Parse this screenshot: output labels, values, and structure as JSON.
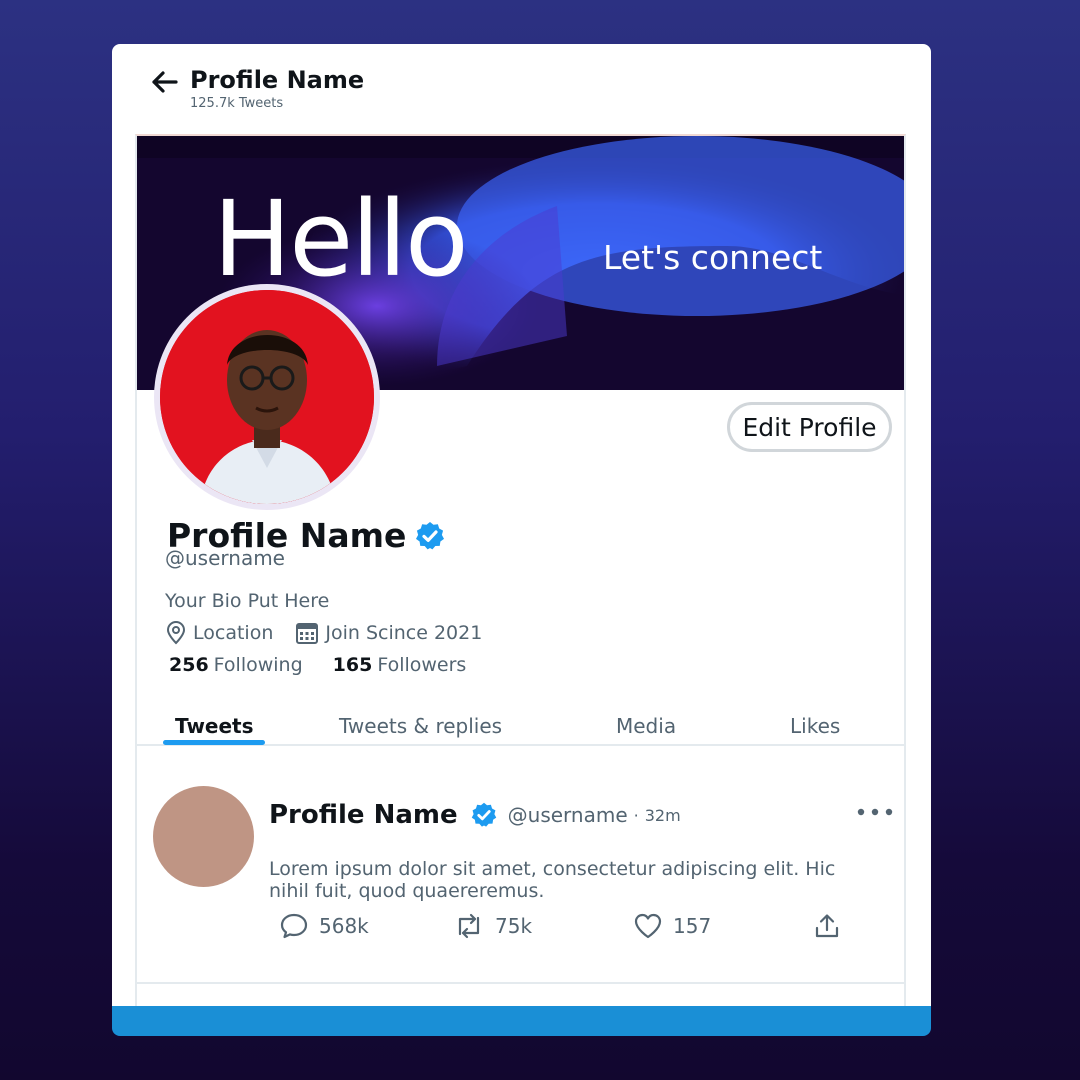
{
  "header": {
    "title": "Profile Name",
    "tweet_count": "125.7k Tweets"
  },
  "banner": {
    "headline": "Hello",
    "tagline": "Let's connect"
  },
  "profile": {
    "edit_label": "Edit Profile",
    "name": "Profile Name",
    "username": "@username",
    "bio": "Your Bio Put Here",
    "location": "Location",
    "joined": "Join Scince 2021",
    "following_count": "256",
    "following_label": "Following",
    "followers_count": "165",
    "followers_label": "Followers"
  },
  "tabs": [
    {
      "label": "Tweets",
      "active": true
    },
    {
      "label": "Tweets & replies",
      "active": false
    },
    {
      "label": "Media",
      "active": false
    },
    {
      "label": "Likes",
      "active": false
    }
  ],
  "tweet": {
    "name": "Profile Name",
    "username": "@username",
    "separator": "·",
    "time": "32m",
    "text": "Lorem ipsum dolor sit amet, consectetur adipiscing elit. Hic nihil fuit, quod quaereremus.",
    "replies": "568k",
    "retweets": "75k",
    "likes": "157"
  },
  "colors": {
    "accent": "#1d9bf0",
    "avatar_bg": "#e2121f",
    "bottom_bar": "#1a8fd6",
    "banner_bg": "#14062f"
  }
}
